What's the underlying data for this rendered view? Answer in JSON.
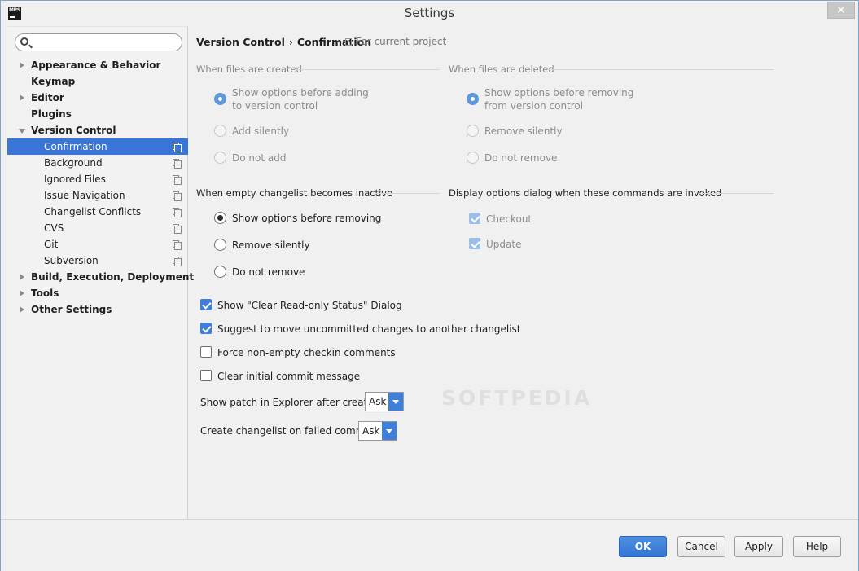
{
  "window": {
    "title": "Settings",
    "icon_text": "MPS",
    "close_glyph": "✕"
  },
  "sidebar": {
    "search_placeholder": "",
    "items": [
      {
        "label": "Appearance & Behavior",
        "level": 0,
        "arrow": "right"
      },
      {
        "label": "Keymap",
        "level": 0,
        "arrow": ""
      },
      {
        "label": "Editor",
        "level": 0,
        "arrow": "right"
      },
      {
        "label": "Plugins",
        "level": 0,
        "arrow": ""
      },
      {
        "label": "Version Control",
        "level": 0,
        "arrow": "down"
      },
      {
        "label": "Confirmation",
        "level": 1,
        "selected": true
      },
      {
        "label": "Background",
        "level": 1
      },
      {
        "label": "Ignored Files",
        "level": 1
      },
      {
        "label": "Issue Navigation",
        "level": 1
      },
      {
        "label": "Changelist Conflicts",
        "level": 1
      },
      {
        "label": "CVS",
        "level": 1
      },
      {
        "label": "Git",
        "level": 1
      },
      {
        "label": "Subversion",
        "level": 1
      },
      {
        "label": "Build, Execution, Deployment",
        "level": 0,
        "arrow": "right"
      },
      {
        "label": "Tools",
        "level": 0,
        "arrow": "right"
      },
      {
        "label": "Other Settings",
        "level": 0,
        "arrow": "right"
      }
    ]
  },
  "header": {
    "crumb_parent": "Version Control",
    "crumb_sep": "›",
    "crumb_current": "Confirmation",
    "scope": "For current project"
  },
  "created": {
    "title": "When files are created",
    "opt1_line1": "Show options before adding",
    "opt1_line2": "to version control",
    "opt2": "Add silently",
    "opt3": "Do not add"
  },
  "deleted": {
    "title": "When files are deleted",
    "opt1_line1": "Show options before removing",
    "opt1_line2": "from version control",
    "opt2": "Remove silently",
    "opt3": "Do not remove"
  },
  "empty_changelist": {
    "title": "When empty changelist becomes inactive",
    "opt1": "Show options before removing",
    "opt2": "Remove silently",
    "opt3": "Do not remove"
  },
  "display_dialog": {
    "title": "Display options dialog when these commands are invoked",
    "checkout": "Checkout",
    "update": "Update"
  },
  "checkboxes": {
    "clear_readonly": "Show \"Clear Read-only Status\" Dialog",
    "suggest_move": "Suggest to move uncommitted changes to another changelist",
    "force_comments": "Force non-empty checkin comments",
    "clear_initial": "Clear initial commit message"
  },
  "combos": {
    "show_patch_label": "Show patch in Explorer after creation:",
    "show_patch_value": "Ask",
    "create_changelist_label": "Create changelist on failed commit:",
    "create_changelist_value": "Ask"
  },
  "watermark": "SOFTPEDIA",
  "buttons": {
    "ok": "OK",
    "cancel": "Cancel",
    "apply": "Apply",
    "help": "Help"
  },
  "colors": {
    "selection": "#3875d7",
    "accent": "#3f7fd9"
  }
}
